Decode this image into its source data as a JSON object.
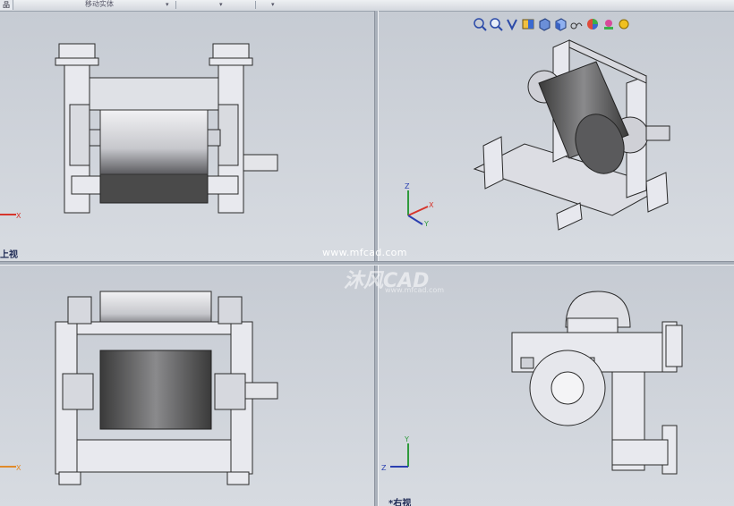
{
  "toolbar": {
    "tab_label": "品",
    "command_label": "移动实体",
    "dropdown_glyph": "▾"
  },
  "views": {
    "top_left_label": "上视",
    "top_right_label": "",
    "bottom_left_label": "",
    "bottom_right_label": "*右视"
  },
  "axes": {
    "x": "X",
    "y": "Y",
    "z": "Z"
  },
  "hud_icons": [
    "zoom-to-fit-icon",
    "zoom-to-area-icon",
    "previous-view-icon",
    "section-view-icon",
    "view-orientation-icon",
    "display-style-icon",
    "hide-show-items-icon",
    "edit-appearance-icon",
    "apply-scene-icon",
    "view-settings-icon"
  ],
  "watermark": {
    "url": "www.mfcad.com",
    "brand": "沐风CAD",
    "sub_url": "www.mfcad.com"
  },
  "colors": {
    "viewport_bg": "#c9ced6",
    "roller_dark": "#4a4a4a",
    "frame_fill": "#e8e9ee",
    "frame_stroke": "#2a2a2a",
    "axis_x": "#d6352c",
    "axis_y": "#2f9a3c",
    "axis_z": "#2a3fb0",
    "label_color": "#1e2a55"
  }
}
